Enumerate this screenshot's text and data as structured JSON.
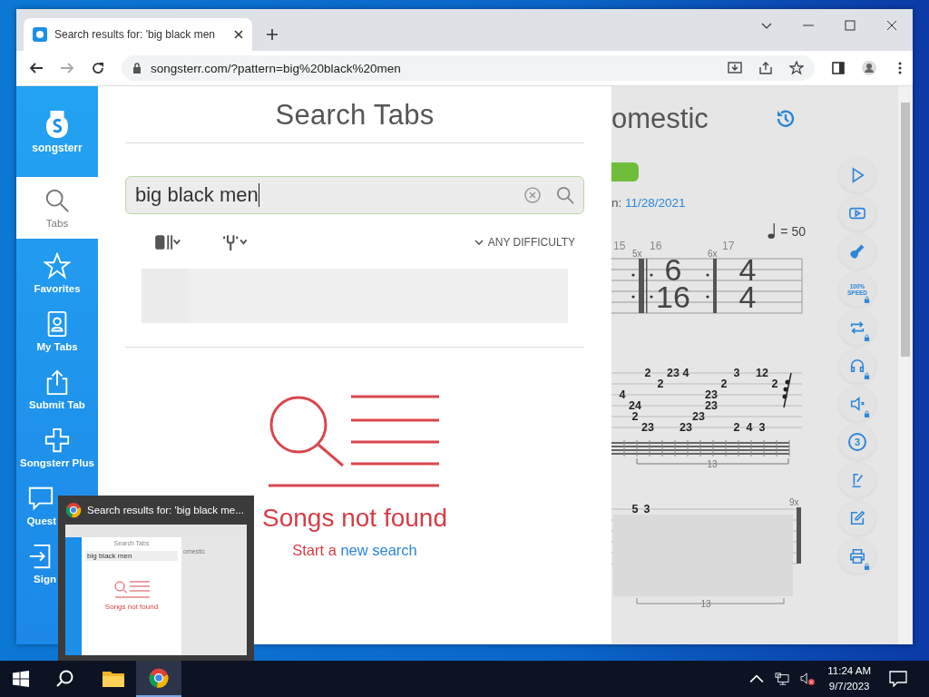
{
  "browser": {
    "tab_title": "Search results for: 'big black men",
    "url": "songsterr.com/?pattern=big%20black%20men"
  },
  "sidebar": {
    "logo": "songsterr",
    "items": [
      {
        "kind": "search",
        "label": "Tabs",
        "selected": true
      },
      {
        "kind": "star",
        "label": "Favorites",
        "selected": false
      },
      {
        "kind": "profile",
        "label": "My Tabs",
        "selected": false
      },
      {
        "kind": "upload",
        "label": "Submit Tab",
        "selected": false
      },
      {
        "kind": "plus",
        "label": "Songsterr Plus",
        "selected": false
      },
      {
        "kind": "faq",
        "label": "Quest",
        "selected": false
      },
      {
        "kind": "signin",
        "label": "Sign",
        "selected": false
      }
    ]
  },
  "search_panel": {
    "title": "Search Tabs",
    "query": "big black men",
    "difficulty": "ANY DIFFICULTY",
    "empty_title": "Songs not found",
    "empty_hint": "Start a",
    "empty_link": "new search"
  },
  "song_page": {
    "title": "omestic",
    "date_prefix": "n:",
    "date": "11/28/2021",
    "tempo": "= 50",
    "measures": [
      {
        "number": "15"
      },
      {
        "number": "16",
        "repeat": "5x",
        "time_signature": [
          "6",
          "16"
        ]
      },
      {
        "number": "17",
        "repeat": "6x",
        "time_signature": [
          "4",
          "4"
        ]
      }
    ],
    "beats": [
      {
        "s3": "4"
      },
      {
        "s4": "24",
        "s5": "2"
      },
      {
        "s1": "2",
        "s6": "23"
      },
      {
        "s2": "2"
      },
      {
        "s1": "23"
      },
      {
        "s1": "4",
        "s6": "23"
      },
      {
        "s5": "23"
      },
      {
        "s3": "23",
        "s4": "23"
      },
      {
        "s2": "2"
      },
      {
        "s1": "3",
        "s6": "2"
      },
      {
        "s6": "4"
      },
      {
        "s1": "12",
        "s6": "3"
      },
      {
        "s2": "2"
      }
    ],
    "bracket_label": "13",
    "lower_staff": {
      "frets": [
        "5",
        "3"
      ],
      "repeat": "9x",
      "bracket_label": "13"
    },
    "tools": [
      {
        "kind": "play",
        "locked": false
      },
      {
        "kind": "video",
        "locked": false
      },
      {
        "kind": "guitar",
        "locked": false
      },
      {
        "kind": "speed",
        "label": "100%",
        "sublabel": "SPEED",
        "locked": true
      },
      {
        "kind": "loop",
        "locked": true
      },
      {
        "kind": "headphones",
        "locked": true
      },
      {
        "kind": "mute",
        "locked": true
      },
      {
        "kind": "countin",
        "label": "3",
        "locked": false
      },
      {
        "kind": "pen",
        "locked": false
      },
      {
        "kind": "edit",
        "locked": false
      },
      {
        "kind": "print",
        "locked": true
      }
    ]
  },
  "thumbnail": {
    "title": "Search results for: 'big black me...",
    "preview_title": "Search Tabs",
    "preview_page_title": "omestic",
    "preview_query": "big black men",
    "preview_empty": "Songs not found"
  },
  "taskbar": {
    "apps": [
      {
        "kind": "explorer",
        "active": false
      },
      {
        "kind": "chrome",
        "active": true
      }
    ],
    "time": "11:24 AM",
    "date": "9/7/2023"
  }
}
